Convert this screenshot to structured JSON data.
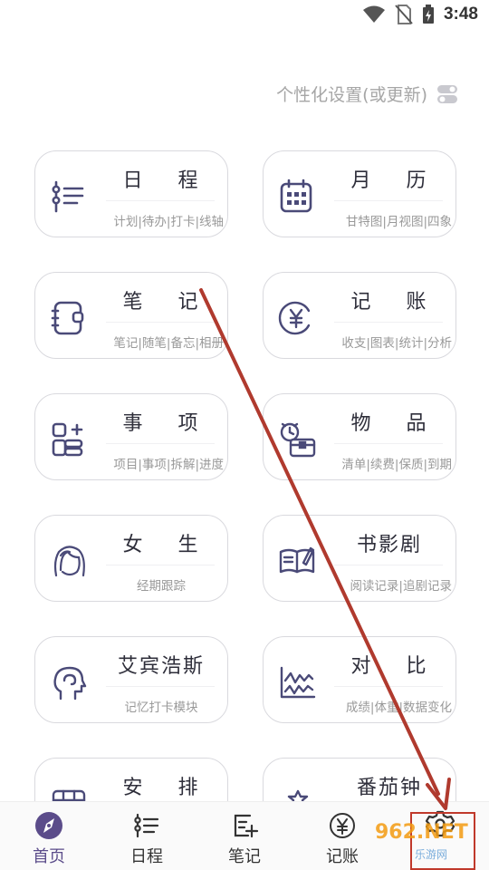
{
  "status_bar": {
    "time": "3:48"
  },
  "settings": {
    "label": "个性化设置(或更新)"
  },
  "cards": [
    {
      "title": "日 程",
      "sub": "计划|待办|打卡|线轴",
      "icon": "schedule-list-icon"
    },
    {
      "title": "月 历",
      "sub": "甘特图|月视图|四象",
      "icon": "calendar-icon"
    },
    {
      "title": "笔 记",
      "sub": "笔记|随笔|备忘|相册",
      "icon": "notebook-icon"
    },
    {
      "title": "记 账",
      "sub": "收支|图表|统计|分析",
      "icon": "yuan-coin-icon"
    },
    {
      "title": "事 项",
      "sub": "项目|事项|拆解|进度",
      "icon": "task-items-icon"
    },
    {
      "title": "物 品",
      "sub": "清单|续费|保质|到期",
      "icon": "item-box-clock-icon"
    },
    {
      "title": "女 生",
      "sub": "经期跟踪",
      "icon": "woman-face-icon"
    },
    {
      "title": "书影剧",
      "sub": "阅读记录|追剧记录",
      "icon": "open-book-icon"
    },
    {
      "title": "艾宾浩斯",
      "sub": "记忆打卡模块",
      "icon": "head-memory-icon"
    },
    {
      "title": "对 比",
      "sub": "成绩|体重|数据变化",
      "icon": "compare-chart-icon"
    },
    {
      "title": "安 排",
      "sub": "",
      "icon": "timetable-icon"
    },
    {
      "title": "番茄钟",
      "sub": "",
      "icon": "tomato-timer-icon"
    }
  ],
  "tabs": [
    {
      "label": "首页",
      "icon": "home-compass-icon"
    },
    {
      "label": "日程",
      "icon": "schedule-list-icon"
    },
    {
      "label": "笔记",
      "icon": "note-add-icon"
    },
    {
      "label": "记账",
      "icon": "yuan-coin-icon"
    },
    {
      "label": "",
      "icon": "settings-gear-icon"
    }
  ],
  "watermark": {
    "main": "962.NET",
    "sub": "乐游网"
  },
  "colors": {
    "accent": "#5b4c8a",
    "icon": "#4a4a78",
    "arrow": "#b03a2e"
  }
}
